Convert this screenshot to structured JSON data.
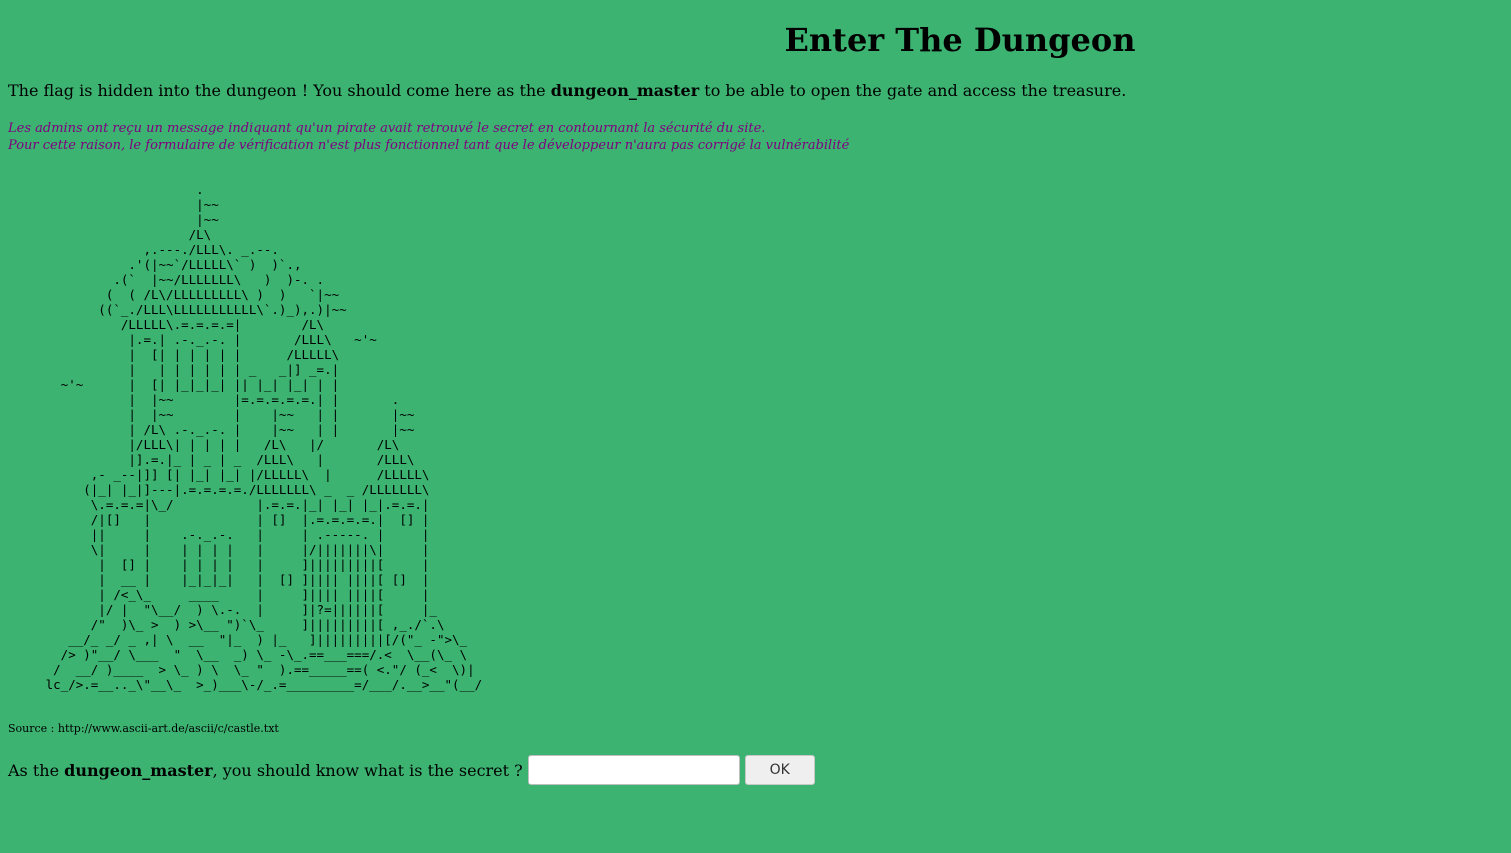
{
  "title": "Enter The Dungeon",
  "intro": {
    "before": "The flag is hidden into the dungeon ! You should come here as the ",
    "username": "dungeon_master",
    "after": " to be able to open the gate and access the treasure."
  },
  "notice": {
    "line1": "Les admins ont reçu un message indiquant qu'un pirate avait retrouvé le secret en contournant la sécurité du site.",
    "line2": "Pour cette raison, le formulaire de vérification n'est plus fonctionnel tant que le développeur n'aura pas corrigé la vulnérabilité"
  },
  "ascii_art": "                         .\n                         |~~\n                         |~~\n                        /L\\\n                  ,.---./LLL\\. _.--.\n                .'(|~~`/LLLLL\\` )  )`.,\n              .(`  |~~/LLLLLLL\\   )  )-. .\n             (  ( /L\\/LLLLLLLLL\\ )  )   `|~~\n            ((`_./LLL\\LLLLLLLLLLL\\`.)_),.)|~~\n               /LLLLL\\.=.=.=.=|        /L\\\n                |.=.| .-._.-. |       /LLL\\   ~'~\n                |  [| | | | | |      /LLLLL\\\n                |   | | | | | | _   _|] _=.|\n       ~'~      |  [| |_|_|_| || |_| |_| | |\n                |  |~~        |=.=.=.=.=.| |       .\n                |  |~~        |    |~~   | |       |~~\n                | /L\\ .-._.-. |    |~~   | |       |~~\n                |/LLL\\| | | | |   /L\\   |/       /L\\\n                |].=.|_ | _ | _  /LLL\\   |       /LLL\\\n           ,- _--|]] [| |_| |_| |/LLLLL\\  |      /LLLLL\\\n          (|_| |_|]---|.=.=.=.=./LLLLLLL\\ _  _ /LLLLLLL\\\n           \\.=.=.=|\\_/           |.=.=.|_| |_| |_|.=.=.|\n           /|[]   |              | []  |.=.=.=.=.|  [] |\n           ||     |    .-._.-.   |     | .-----. |     |\n           \\|     |    | | | |   |     |/|||||||\\|     |\n            |  [] |    | | | |   |     ]|||||||||[     |\n            |  __ |    |_|_|_|   |  [] ]|||| ||||[ []  |\n            | /<_\\_     ____     |     ]|||| ||||[     |\n            |/ |  \"\\__/  ) \\.-.  |     ]|?=||||||[     |_\n           /\"  )\\_ >  ) >\\__ \")`\\_     ]|||||||||[ ,_./`.\\\n        __/_ _/ _ ,| \\  __  \"|_  ) |_   ]|||||||||[/(\"_ -\">\\_\n       /> )\"__/ \\___  \"  \\__  _) \\_ -\\_.==___===/.<  \\__(\\_ \\\n      /  __/ )____  > \\_ ) \\  \\_ \"  ).==_____==( <.\"/ (_<  \\)|\n     lc_/>.=__.._\\\"__\\_  >_)___\\-/_.=_________=/___/.__>__\"(__/",
  "source": "Source : http://www.ascii-art.de/ascii/c/castle.txt",
  "secret_prompt": {
    "before": "As the ",
    "username": "dungeon_master",
    "after": ", you should know what is the secret ?"
  },
  "secret_input": {
    "value": "",
    "placeholder": ""
  },
  "ok_button_label": "OK"
}
